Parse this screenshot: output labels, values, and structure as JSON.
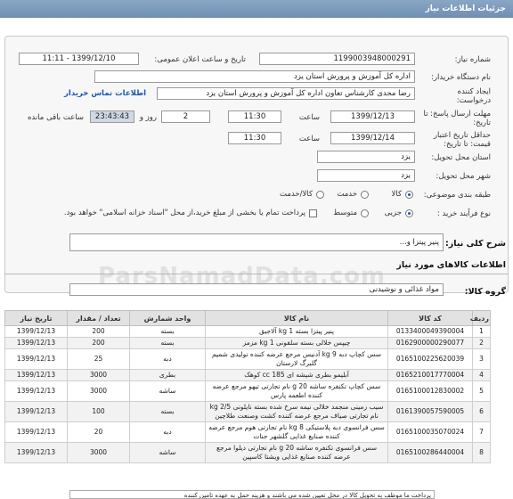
{
  "page_title": "جزئیات اطلاعات نیاز",
  "fields": {
    "need_number_label": "شماره نیاز:",
    "need_number": "1199003948000291",
    "announce_label": "تاریخ و ساعت اعلان عمومی:",
    "announce_value": "1399/12/10 - 11:11",
    "buyer_label": "نام دستگاه خریدار:",
    "buyer_value": "اداره کل آموزش و پرورش استان یزد",
    "creator_label": "ایجاد کننده درخواست:",
    "creator_value": "رضا مجدی کارشناس تعاون اداره کل آموزش و پرورش استان یزد",
    "contact_link": "اطلاعات تماس خریدار",
    "reply_deadline_label": "مهلت ارسال پاسخ: تا تاریخ:",
    "reply_date": "1399/12/13",
    "time_label": "ساعت",
    "reply_time": "11:30",
    "days_value": "2",
    "days_label": "روز و",
    "remaining_time": "23:43:43",
    "remaining_label": "ساعت باقی مانده",
    "validity_label": "حداقل تاریخ اعتبار قیمت: تا تاریخ:",
    "validity_date": "1399/12/14",
    "validity_time": "11:30",
    "province_label": "استان محل تحویل:",
    "province_value": "یزد",
    "city_label": "شهر محل تحویل:",
    "city_value": "یزد",
    "category_label": "طبقه بندی موضوعی:",
    "category_options": [
      "کالا",
      "خدمت",
      "کالا/خدمت"
    ],
    "process_label": "نوع فرآیند خرید :",
    "process_options": [
      "جزیی",
      "متوسط"
    ],
    "payment_note": "پرداخت تمام یا بخشی از مبلغ خرید،از محل \"اسناد خزانه اسلامی\" خواهد بود."
  },
  "summary": {
    "label": "شرح کلی نیاز:",
    "value": "پنیر پیتزا و..."
  },
  "goods_header": "اطلاعات کالاهای مورد نیاز",
  "goods_group": {
    "label": "گروه کالا:",
    "value": "مواد غذائی و نوشیدنی"
  },
  "watermark": "ParsNamadData.com",
  "table": {
    "headers": [
      "ردیف",
      "کد کالا",
      "نام کالا",
      "واحد شمارش",
      "تعداد / مقدار",
      "تاریخ نیاز"
    ],
    "rows": [
      [
        "1",
        "0133400049390004",
        "پنیر پیتزا بسته 1 kg آلاجیق",
        "بسته",
        "200",
        "1399/12/13"
      ],
      [
        "2",
        "0162900000290077",
        "چیپس خلالی بسته سلفونی 1 kg مزمز",
        "بسته",
        "200",
        "1399/12/13"
      ],
      [
        "3",
        "0165100225620039",
        "سس کچاپ دبه 9 kg آدنیس مرجع عرضه کننده تولیدی شمیم گلبرگ لارستان",
        "دبه",
        "25",
        "1399/12/13"
      ],
      [
        "4",
        "0165210017770004",
        "آبلیمو بطری شیشه ای 185 cc کوهک",
        "بطری",
        "3000",
        "1399/12/13"
      ],
      [
        "5",
        "0165100012830002",
        "سس کچاپ تکنفره ساشه 20 g نام تجارتی تیهو مرجع عرضه کننده اطعمه پارس",
        "ساشه",
        "3000",
        "1399/12/13"
      ],
      [
        "6",
        "0161390057590005",
        "سیب زمینی منجمد خلالی نیمه سرخ شده بسته نایلونی 2/5 kg نام تجارتی صیاف مرجع عرضه کننده کشت وصنعت طلاچین",
        "بسته",
        "100",
        "1399/12/13"
      ],
      [
        "7",
        "0165100035070024",
        "سس فرانسوی دبه پلاستیکی 8 kg نام تجارتی هوم مرجع عرضه کننده صنایع غذایی گلشهر جنات",
        "دبه",
        "20",
        "1399/12/13"
      ],
      [
        "8",
        "0165100286440004",
        "سس فرانسوی تکنفره ساشه 20 g نام تجارتی دیلوا مرجع عرضه کننده صنایع غذایی ویشتا کاسپین",
        "ساشه",
        "3000",
        "1399/12/13"
      ]
    ]
  },
  "bottom_note": "پرداخت ما موظف به تحویل کالا در محل تعیین شده می باشند و هزینه حمل به عهده تامین کننده"
}
